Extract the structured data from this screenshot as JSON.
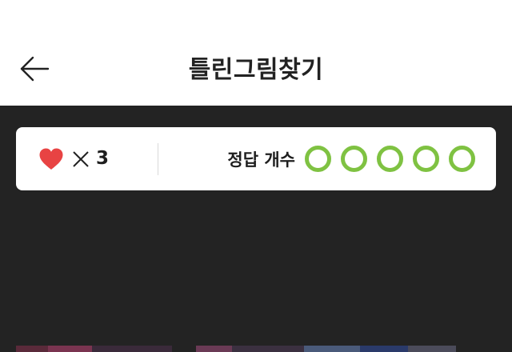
{
  "header": {
    "title": "틀린그림찾기",
    "back_icon": "arrow-left-icon"
  },
  "status": {
    "lives_icon": "heart-icon",
    "times_icon": "close-icon",
    "lives_count": "3",
    "answers_label": "정답 개수",
    "answers_found": 0,
    "answers_total": 5,
    "answer_icon": "circle-outline-icon"
  },
  "colors": {
    "header_bg": "#ffffff",
    "game_bg": "#232323",
    "heart": "#e84343",
    "answer_ring": "#7fc242",
    "text": "#1e1e1e"
  }
}
